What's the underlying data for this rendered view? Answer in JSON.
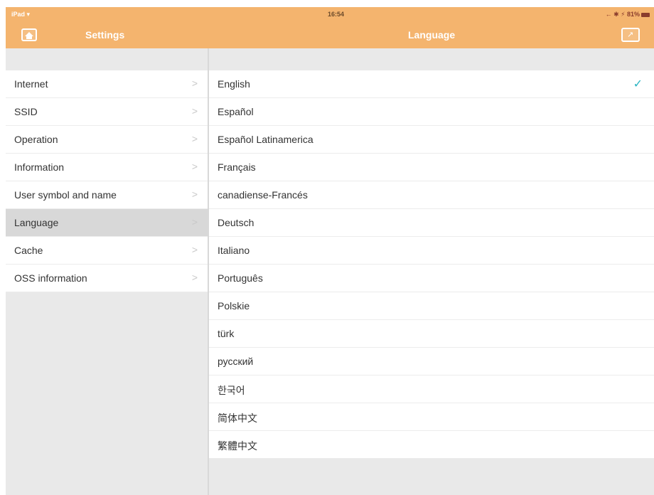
{
  "status_bar": {
    "device": "iPad",
    "wifi": "wifi-icon",
    "time": "16:54",
    "right": "← ✱ ⚡ 81%"
  },
  "nav": {
    "left_title": "Settings",
    "right_title": "Language",
    "home_icon": "home-icon",
    "share_icon": "share-icon",
    "bar_color": "#f4b46e"
  },
  "sidebar": {
    "items": [
      {
        "label": "Internet",
        "chevron": ">"
      },
      {
        "label": "SSID",
        "chevron": ">"
      },
      {
        "label": "Operation",
        "chevron": ">"
      },
      {
        "label": "Information",
        "chevron": ">"
      },
      {
        "label": "User symbol and name",
        "chevron": ">"
      },
      {
        "label": "Language",
        "chevron": ">",
        "selected": true
      },
      {
        "label": "Cache",
        "chevron": ">"
      },
      {
        "label": "OSS information",
        "chevron": ">"
      }
    ]
  },
  "languages": {
    "items": [
      {
        "label": "English",
        "checked": true
      },
      {
        "label": "Español"
      },
      {
        "label": "Español Latinamerica"
      },
      {
        "label": "Français"
      },
      {
        "label": "canadiense-Francés"
      },
      {
        "label": "Deutsch"
      },
      {
        "label": "Italiano"
      },
      {
        "label": "Português"
      },
      {
        "label": "Polskie"
      },
      {
        "label": "türk"
      },
      {
        "label": "русский"
      },
      {
        "label": "한국어"
      },
      {
        "label": "简体中文"
      },
      {
        "label": "繁體中文"
      }
    ],
    "checkmark": "✓",
    "check_color": "#2ab4c2"
  }
}
